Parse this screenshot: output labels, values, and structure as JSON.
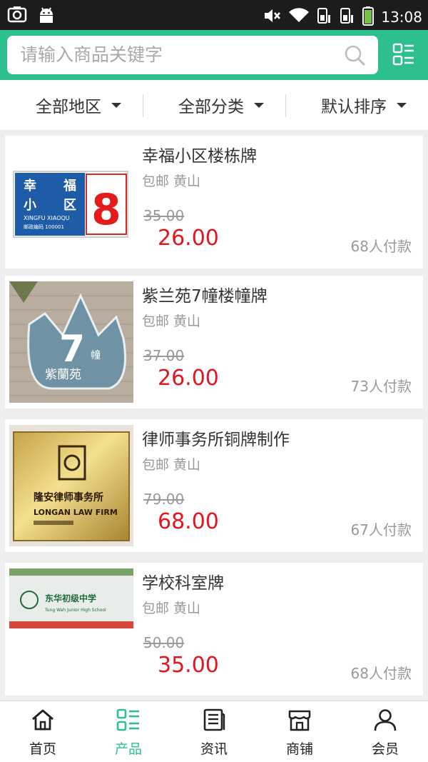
{
  "status_bar": {
    "time": "13:08"
  },
  "search": {
    "placeholder": "请输入商品关键字"
  },
  "filters": [
    {
      "label": "全部地区"
    },
    {
      "label": "全部分类"
    },
    {
      "label": "默认排序"
    }
  ],
  "products": [
    {
      "title": "幸福小区楼栋牌",
      "sub": "包邮 黄山",
      "original_price": "35.00",
      "price": "26.00",
      "sold": "68人付款",
      "image": {
        "line1a": "幸",
        "line1b": "福",
        "line2a": "小",
        "line2b": "区",
        "pinyin": "XINGFU  XIAOQU",
        "postal": "邮政编码  100001",
        "number": "8"
      }
    },
    {
      "title": "紫兰苑7幢楼幢牌",
      "sub": "包邮 黄山",
      "original_price": "37.00",
      "price": "26.00",
      "sold": "73人付款",
      "image": {
        "number": "7",
        "unit": "幢",
        "name": "紫蘭苑"
      }
    },
    {
      "title": "律师事务所铜牌制作",
      "sub": "包邮 黄山",
      "original_price": "79.00",
      "price": "68.00",
      "sold": "67人付款",
      "image": {
        "cn": "隆安律师事务所",
        "en": "LONGAN LAW FIRM"
      }
    },
    {
      "title": "学校科室牌",
      "sub": "包邮 黄山",
      "original_price": "50.00",
      "price": "35.00",
      "sold": "68人付款",
      "image": {
        "cn": "东华初级中学",
        "en": "Tung Wah Junior High School"
      }
    }
  ],
  "tabs": [
    {
      "label": "首页",
      "icon": "home-icon",
      "active": false
    },
    {
      "label": "产品",
      "icon": "list-icon",
      "active": true
    },
    {
      "label": "资讯",
      "icon": "news-icon",
      "active": false
    },
    {
      "label": "商铺",
      "icon": "shop-icon",
      "active": false
    },
    {
      "label": "会员",
      "icon": "user-icon",
      "active": false
    }
  ],
  "colors": {
    "accent": "#2ebf91",
    "price": "#e4151d",
    "status_bar": "#1c1c1c"
  }
}
